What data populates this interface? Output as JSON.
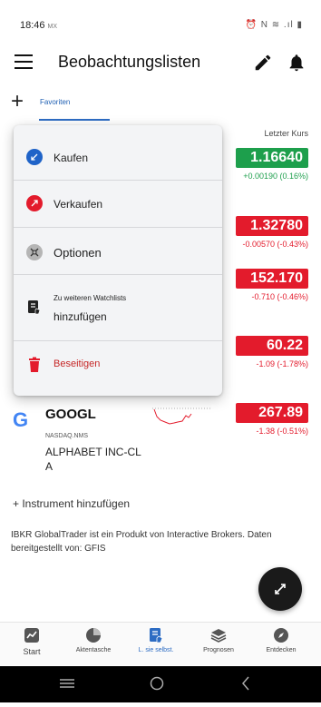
{
  "status": {
    "time": "18:46",
    "carrier": "MX",
    "icons_text": "⏰ N ≋ .ıl ▮"
  },
  "appbar": {
    "title": "Beobachtungslisten"
  },
  "tabs": [
    {
      "label": "Favoriten",
      "active": true
    }
  ],
  "list": {
    "column_header": "Letzter Kurs",
    "rows": [
      {
        "price": "1.16640",
        "change": "+0.00190 (0.16%)",
        "trend": "up"
      },
      {
        "price": "1.32780",
        "change": "-0.00570 (-0.43%)",
        "trend": "down"
      },
      {
        "price": "152.170",
        "change": "-0.710 (-0.46%)",
        "trend": "down"
      },
      {
        "price": "60.22",
        "change": "-1.09 (-1.78%)",
        "trend": "down"
      },
      {
        "symbol": "GOOGL",
        "logo": "G",
        "exchange": "NASDAQ.NMS",
        "name": "ALPHABET INC-CL A",
        "price": "267.89",
        "change": "-1.38 (-0.51%)",
        "trend": "down"
      }
    ]
  },
  "add_instrument": "+ Instrument hinzufügen",
  "disclaimer": "IBKR GlobalTrader ist ein Produkt von Interactive Brokers. Daten bereitgestellt von: GFIS",
  "menu": {
    "buy": "Kaufen",
    "sell": "Verkaufen",
    "options": "Optionen",
    "add_to_watchlists_small": "Zu weiteren Watchlists",
    "add_to_watchlists": "hinzufügen",
    "remove": "Beseitigen"
  },
  "bottom_nav": [
    {
      "label": "Start",
      "icon": "chart-icon"
    },
    {
      "label": "Aktentasche",
      "icon": "pie-icon"
    },
    {
      "label": "L. sie selbst.",
      "icon": "watchlist-icon",
      "active": true
    },
    {
      "label": "Prognosen",
      "icon": "layers-icon"
    },
    {
      "label": "Entdecken",
      "icon": "compass-icon"
    }
  ],
  "colors": {
    "accent": "#2d6cc3",
    "up": "#1d9f4c",
    "down": "#e31b2c",
    "remove": "#e31b2c"
  }
}
